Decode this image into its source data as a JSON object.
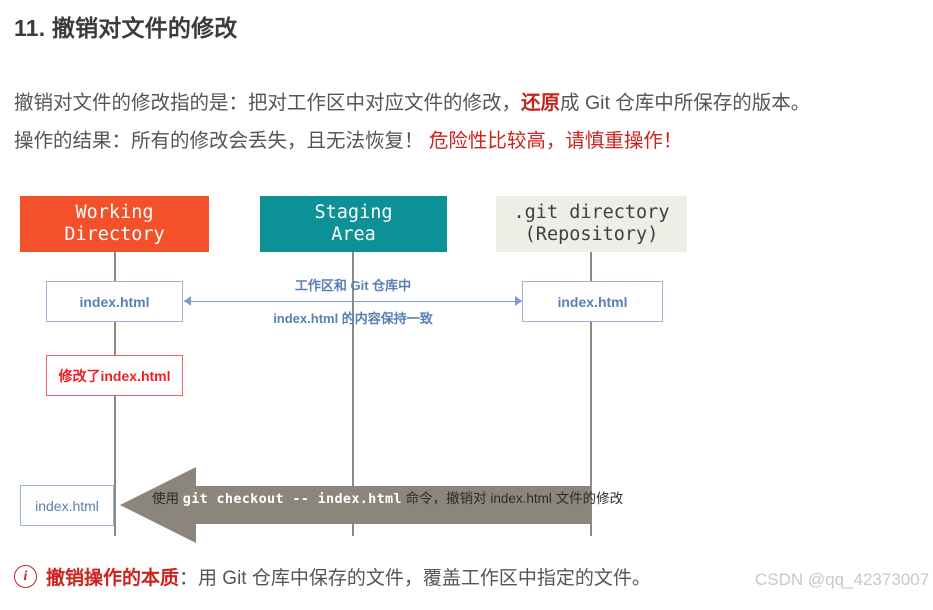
{
  "page": {
    "title": "11. 撤销对文件的修改"
  },
  "paragraphs": {
    "p1_prefix": "撤销对文件的修改指的是：把对工作区中对应文件的修改，",
    "p1_emph": "还原",
    "p1_suffix": "成 Git 仓库中所保存的版本。",
    "p2_prefix": "操作的结果：所有的修改会丢失，且无法恢复！ ",
    "p2_warn": "危险性比较高，请慎重操作！"
  },
  "diagram": {
    "columns": [
      {
        "id": "working",
        "label": "Working\nDirectory",
        "color": "#f4502a"
      },
      {
        "id": "staging",
        "label": "Staging\nArea",
        "color": "#0e9097"
      },
      {
        "id": "git",
        "label": ".git directory\n(Repository)",
        "color": "#eeeee6"
      }
    ],
    "file_working_top": "index.html",
    "file_git_top": "index.html",
    "file_working_bottom": "index.html",
    "modified_box": "修改了index.html",
    "sync_label_line1": "工作区和 Git 仓库中",
    "sync_label_line2": "index.html 的内容保持一致",
    "checkout": {
      "prefix": "使用 ",
      "command": "git checkout -- index.html",
      "suffix": " 命令，撤销对 index.html 文件的修改",
      "arrow_color": "#8c857c"
    }
  },
  "note": {
    "icon": "i",
    "emph": "撤销操作的本质",
    "rest": "：用 Git 仓库中保存的文件，覆盖工作区中指定的文件。"
  },
  "watermark": "CSDN @qq_42373007"
}
